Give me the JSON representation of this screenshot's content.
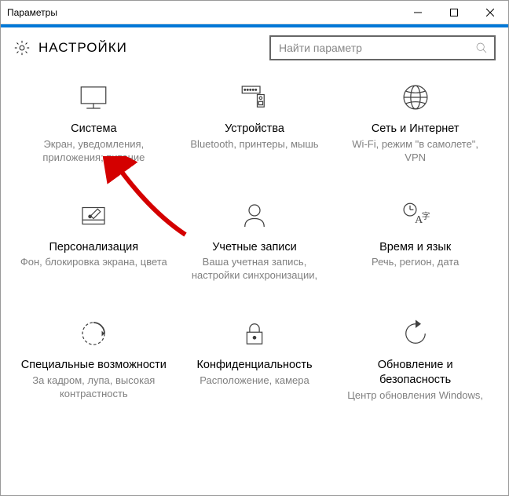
{
  "window": {
    "title": "Параметры"
  },
  "header": {
    "title": "НАСТРОЙКИ"
  },
  "search": {
    "placeholder": "Найти параметр"
  },
  "tiles": [
    {
      "title": "Система",
      "desc": "Экран, уведомления, приложения; питание"
    },
    {
      "title": "Устройства",
      "desc": "Bluetooth, принтеры, мышь"
    },
    {
      "title": "Сеть и Интернет",
      "desc": "Wi-Fi, режим \"в самолете\", VPN"
    },
    {
      "title": "Персонализация",
      "desc": "Фон, блокировка экрана, цвета"
    },
    {
      "title": "Учетные записи",
      "desc": "Ваша учетная запись, настройки синхронизации,"
    },
    {
      "title": "Время и язык",
      "desc": "Речь, регион, дата"
    },
    {
      "title": "Специальные возможности",
      "desc": "За кадром, лупа, высокая контрастность"
    },
    {
      "title": "Конфиденциальность",
      "desc": "Расположение, камера"
    },
    {
      "title": "Обновление и безопасность",
      "desc": "Центр обновления Windows,"
    }
  ]
}
